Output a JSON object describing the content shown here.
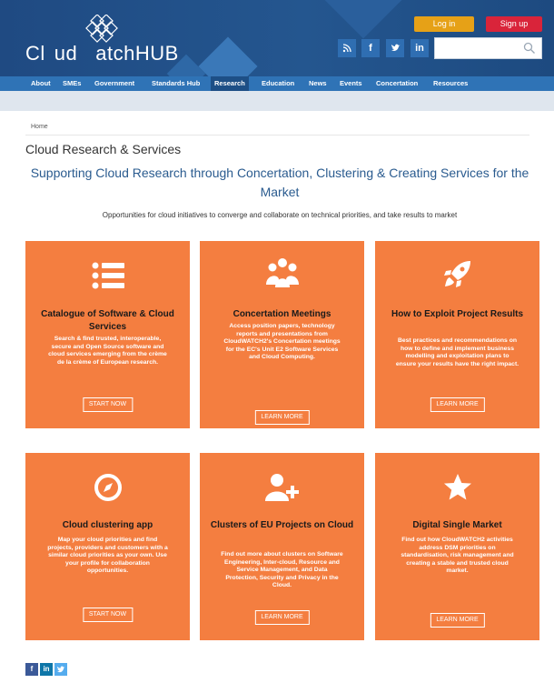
{
  "header": {
    "logo_text_left": "Cl",
    "logo_text_mid": "ud",
    "logo_text_right": "atchHUB",
    "login_label": "Log in",
    "signup_label": "Sign up",
    "social": [
      {
        "icon": "rss-icon",
        "glyph": "ɐ"
      },
      {
        "icon": "facebook-icon",
        "glyph": "f"
      },
      {
        "icon": "twitter-icon",
        "glyph": "❚"
      },
      {
        "icon": "linkedin-icon",
        "glyph": "in"
      }
    ],
    "search_placeholder": ""
  },
  "nav": {
    "items": [
      "About",
      "SMEs",
      "Government",
      "Standards Hub",
      "Research",
      "Education",
      "News",
      "Events",
      "Concertation",
      "Resources"
    ],
    "active": "Research"
  },
  "breadcrumb": "Home",
  "page_title": "Cloud Research & Services",
  "headline": "Supporting Cloud Research through Concertation, Clustering & Creating Services for the Market",
  "intro": "Opportunities for cloud initiatives to converge and collaborate on technical priorities, and take results to market",
  "cards": [
    {
      "title": "Catalogue of Software & Cloud Services",
      "desc": "Search & find trusted, interoperable, secure and Open Source software and cloud services emerging from the crème de la crème of European research.",
      "button": "START NOW"
    },
    {
      "title": "Concertation Meetings",
      "desc": "Access position papers, technology reports and presentations from CloudWATCH2's Concertation meetings for the EC's Unit E2 Software Services and Cloud Computing.",
      "button": "LEARN MORE"
    },
    {
      "title": "How to Exploit Project Results",
      "desc": "Best practices and recommendations on how to define and implement business modelling and exploitation plans to ensure your results have the right impact.",
      "button": "LEARN MORE"
    },
    {
      "title": "Cloud clustering app",
      "desc": "Map your cloud priorities and find projects, providers and customers with a similar cloud priorities as your own. Use your profile for collaboration opportunities.",
      "button": "START NOW"
    },
    {
      "title": "Clusters of EU Projects on Cloud",
      "desc": "Find out more about clusters on Software Engineering, Inter-cloud, Resource and Service Management, and Data Protection, Security and Privacy in the Cloud.",
      "button": "LEARN MORE"
    },
    {
      "title": "Digital Single Market",
      "desc": "Find out how CloudWATCH2 activities address DSM priorities on standardisation, risk management and creating a stable and trusted cloud market.",
      "button": "LEARN MORE"
    }
  ],
  "footer_social": [
    {
      "icon": "facebook-icon",
      "glyph": "f",
      "color": "#3b5998"
    },
    {
      "icon": "linkedin-icon",
      "glyph": "in",
      "color": "#0e76a8"
    },
    {
      "icon": "twitter-icon",
      "glyph": "t",
      "color": "#55acee"
    }
  ],
  "colors": {
    "header": "#24568f",
    "nav": "#2f73b6",
    "card": "#f47e40",
    "login": "#e6a117",
    "signup": "#d9243a",
    "headline": "#2a5b8f"
  }
}
